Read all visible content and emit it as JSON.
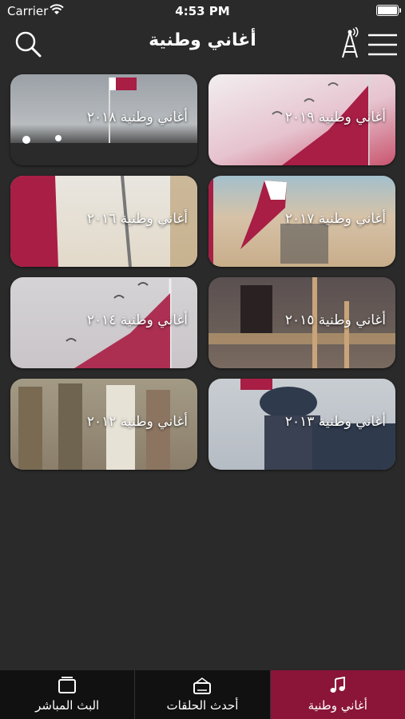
{
  "status_bar": {
    "carrier": "Carrier",
    "time": "4:53 PM"
  },
  "nav": {
    "title": "أغاني وطنية"
  },
  "cards": [
    {
      "label": "أغاني وطنية ٢٠١٩"
    },
    {
      "label": "أغاني وطنية ٢٠١٨"
    },
    {
      "label": "أغاني وطنية ٢٠١٧"
    },
    {
      "label": "أغاني وطنية ٢٠١٦"
    },
    {
      "label": "أغاني وطنية ٢٠١٥"
    },
    {
      "label": "أغاني وطنية ٢٠١٤"
    },
    {
      "label": "أغاني وطنية ٢٠١٣"
    },
    {
      "label": "أغاني وطنية ٢٠١٢"
    }
  ],
  "tabs": [
    {
      "label": "البث المباشر",
      "icon": "tv-icon"
    },
    {
      "label": "أحدث الحلقات",
      "icon": "radio-icon"
    },
    {
      "label": "أغاني وطنية",
      "icon": "music-note-icon",
      "active": true
    }
  ],
  "colors": {
    "accent": "#8a1538",
    "background": "#2a2a2a",
    "tab_bar": "#111111"
  }
}
